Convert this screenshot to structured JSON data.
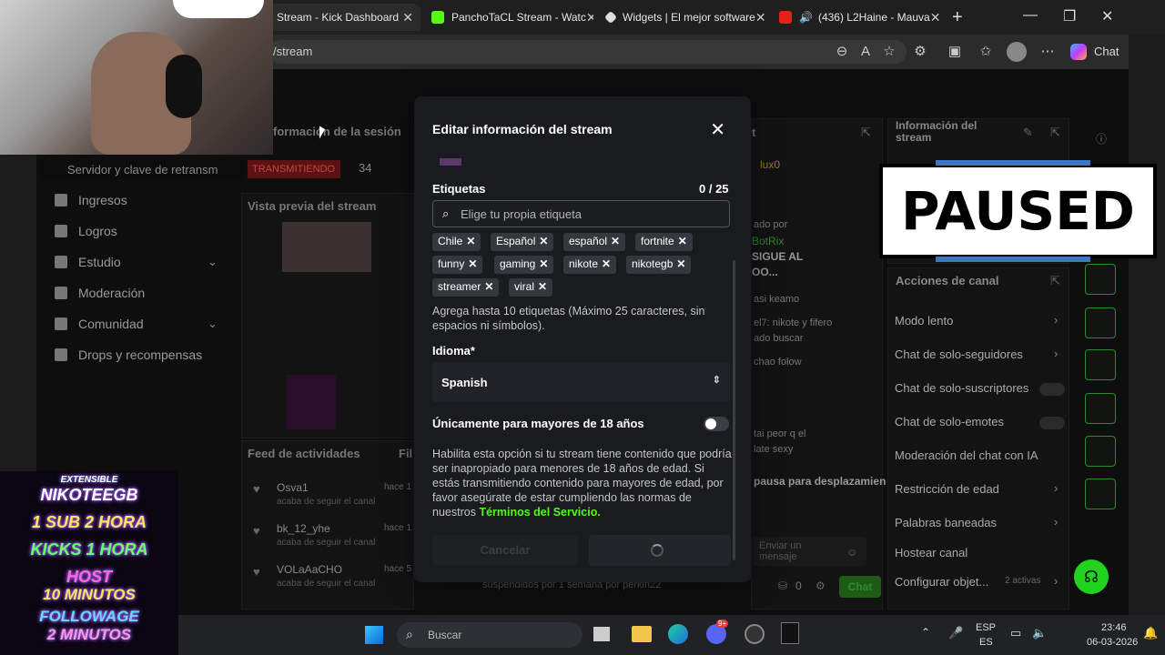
{
  "browser": {
    "tabs": [
      {
        "label": "Stream - Kick Dashboard",
        "icon": "kick-icon"
      },
      {
        "label": "PanchoTaCL Stream - Watc",
        "icon": "kick-icon"
      },
      {
        "label": "Widgets | El mejor software",
        "icon": "widget-icon"
      },
      {
        "label": "(436) L2Haine - Mauva",
        "icon": "youtube-icon"
      }
    ],
    "url": "/stream",
    "chat_label": "Chat"
  },
  "sidebar": {
    "session_title": "formación de la sesión",
    "server_key": "Servidor y clave de retransm",
    "live_badge": "TRANSMITIENDO",
    "viewer_count": "34",
    "items": [
      {
        "label": "Ingresos"
      },
      {
        "label": "Logros"
      },
      {
        "label": "Estudio"
      },
      {
        "label": "Moderación"
      },
      {
        "label": "Comunidad"
      },
      {
        "label": "Drops y recompensas"
      }
    ]
  },
  "preview": {
    "title": "Vista previa del stream"
  },
  "activity": {
    "title": "Feed de actividades",
    "filter": "Fil",
    "items": [
      {
        "name": "Osva1",
        "sub": "acaba de seguir el canal",
        "time": "hace 1"
      },
      {
        "name": "bk_12_yhe",
        "sub": "acaba de seguir el canal",
        "time": "hace 1"
      },
      {
        "name": "VOLaAaCHO",
        "sub": "acaba de seguir el canal",
        "time": "hace 5"
      }
    ]
  },
  "chat_col": {
    "title": "t",
    "user1": "lux0",
    "notice": "ado por",
    "bot": "BotRix",
    "sigue": "SIGUE AL",
    "dots": "OO...",
    "lines": [
      "asi keamo",
      "el7: nikote y fifero",
      "ado buscar",
      "chao folow",
      "tai peor q el",
      "late sexy"
    ],
    "pause_text": "pausa para desplazamien",
    "input_placeholder": "Enviar un mensaje",
    "count": "0",
    "chat_button": "Chat",
    "suspend_text": "suspendidos por 1 semana por perkin22"
  },
  "channel_info": {
    "title": "Información del stream"
  },
  "channel_actions": {
    "title": "Acciones de canal",
    "items": [
      {
        "label": "Modo lento"
      },
      {
        "label": "Chat de solo-seguidores"
      },
      {
        "label": "Chat de solo-suscriptores"
      },
      {
        "label": "Chat de solo-emotes"
      },
      {
        "label": "Moderación del chat con IA"
      },
      {
        "label": "Restricción de edad"
      },
      {
        "label": "Palabras baneadas"
      },
      {
        "label": "Hostear canal"
      },
      {
        "label": "Configurar objet..."
      }
    ],
    "active_count": "2 activas"
  },
  "modal": {
    "title": "Editar información del stream",
    "tags_label": "Etiquetas",
    "tags_count": "0 / 25",
    "search_placeholder": "Elige tu propia etiqueta",
    "tags": [
      "Chile",
      "Español",
      "español",
      "fortnite",
      "funny",
      "gaming",
      "nikote",
      "nikotegb",
      "streamer",
      "viral"
    ],
    "tags_help": "Agrega hasta 10 etiquetas (Máximo 25 caracteres, sin espacios ni símbolos).",
    "language_label": "Idioma*",
    "language_value": "Spanish",
    "mature_label": "Únicamente para mayores de 18 años",
    "mature_help": "Habilita esta opción si tu stream tiene contenido que podría ser inapropiado para menores de 18 años de edad. Si estás transmitiendo contenido para mayores de edad, por favor asegúrate de estar cumpliendo las normas de nuestros",
    "mature_link": "Términos del Servicio.",
    "cancel_label": "Cancelar",
    "mature_enabled": false
  },
  "overlay": {
    "paused_label": "PAUSED",
    "promo_lines": [
      "EXTENSIBLE",
      "NIKOTEEGB",
      "1 SUB 2 HORA",
      "KICKS 1 HORA",
      "HOST",
      "10 MINUTOS",
      "FOLLOWAGE",
      "2 MINUTOS"
    ]
  },
  "taskbar": {
    "search_placeholder": "Buscar",
    "lang": "ESP",
    "lang2": "ES",
    "time": "23:46",
    "date": "06-03-2026",
    "badge": "9+"
  },
  "colors": {
    "kick_green": "#53fc18",
    "live_red": "#e53935"
  }
}
